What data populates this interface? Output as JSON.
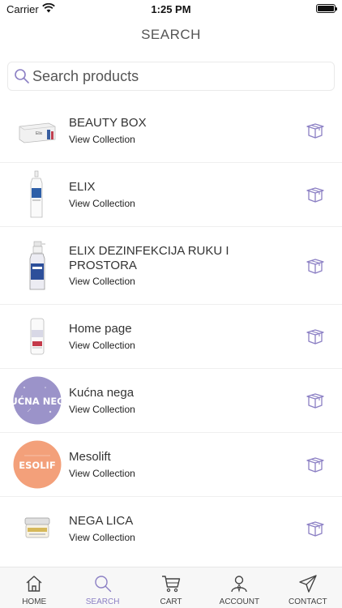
{
  "status_bar": {
    "carrier": "Carrier",
    "time": "1:25 PM"
  },
  "header": {
    "title": "SEARCH"
  },
  "search": {
    "placeholder": "Search products"
  },
  "accent_color": "#8b7fc4",
  "collections": [
    {
      "name": "BEAUTY BOX",
      "subtitle": "View Collection",
      "thumb": "box-product"
    },
    {
      "name": "ELIX",
      "subtitle": "View Collection",
      "thumb": "bottle-product"
    },
    {
      "name": "ELIX DEZINFEKCIJA RUKU I PROSTORA",
      "subtitle": "View Collection",
      "thumb": "spray-product"
    },
    {
      "name": "Home page",
      "subtitle": "View Collection",
      "thumb": "tube-product"
    },
    {
      "name": "Kućna nega",
      "subtitle": "View Collection",
      "thumb": "circle-badge",
      "badge_text": "UĆNA NEG",
      "badge_color": "#9b93c9"
    },
    {
      "name": "Mesolift",
      "subtitle": "View Collection",
      "thumb": "circle-badge",
      "badge_text": "ESOLIF",
      "badge_color": "#f3a07a"
    },
    {
      "name": "NEGA LICA",
      "subtitle": "View Collection",
      "thumb": "jar-product"
    }
  ],
  "tabbar": {
    "tabs": [
      {
        "label": "HOME",
        "icon": "home-icon"
      },
      {
        "label": "SEARCH",
        "icon": "search-icon",
        "active": true
      },
      {
        "label": "CART",
        "icon": "cart-icon"
      },
      {
        "label": "ACCOUNT",
        "icon": "account-icon"
      },
      {
        "label": "CONTACT",
        "icon": "send-icon"
      }
    ]
  }
}
